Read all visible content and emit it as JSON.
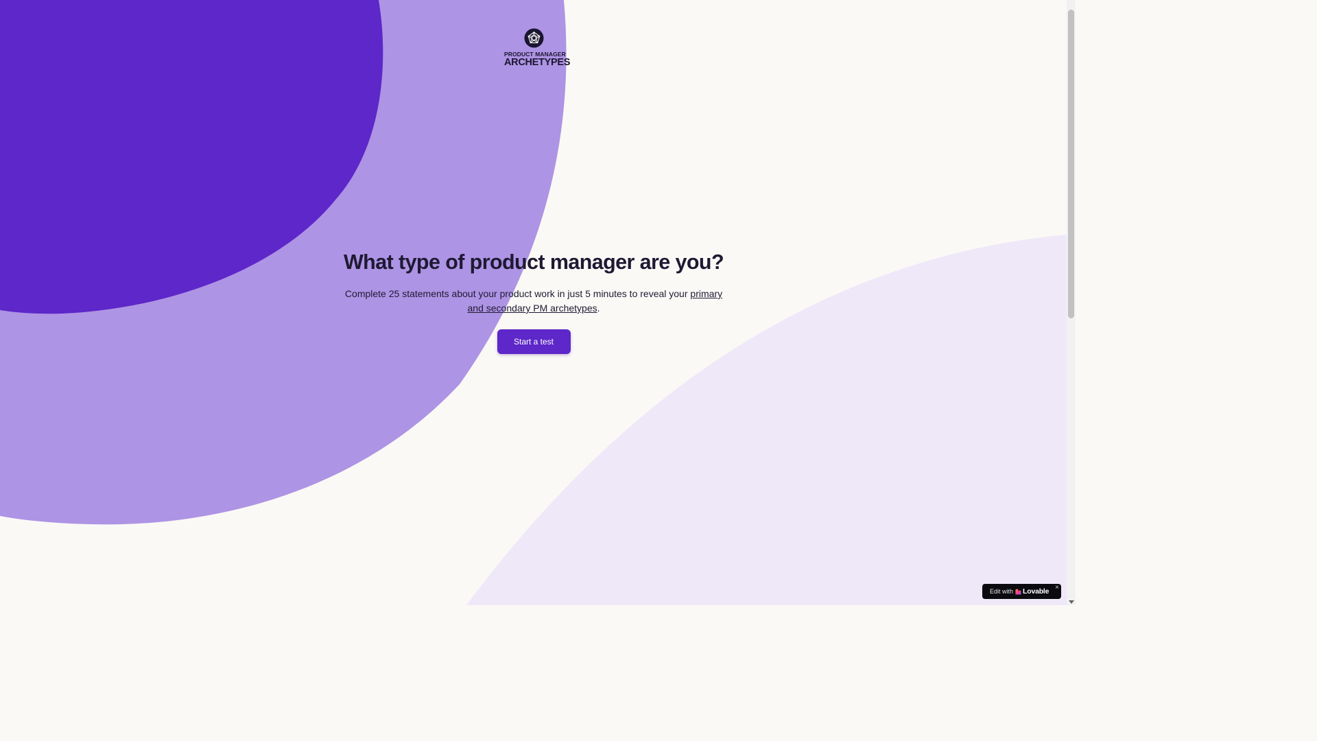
{
  "logo": {
    "line1": "PRODUCT MANAGER",
    "line2": "ARCHETYPES",
    "icon": "pentagon-star-icon"
  },
  "hero": {
    "title": "What type of product manager are you?",
    "description_before": "Complete 25 statements about your product work in just 5 minutes to reveal your ",
    "description_link": "primary and secondary PM archetypes",
    "description_after": ".",
    "cta_label": "Start a test"
  },
  "badge": {
    "prefix": "Edit with",
    "brand": "Lovable",
    "close": "×"
  },
  "colors": {
    "background": "#fbf9f6",
    "blob_dark": "#5d27c9",
    "blob_mid": "#ae94e4",
    "blob_light": "#efe8f8",
    "text": "#1e1a33",
    "button": "#5d27c9"
  }
}
